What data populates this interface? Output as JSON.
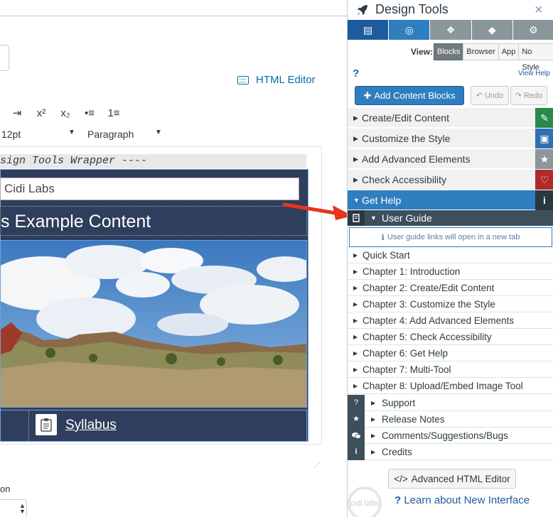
{
  "editor": {
    "html_editor_label": "HTML Editor",
    "toolbar": {
      "indent": "⇥",
      "superscript": "x²",
      "subscript": "x₂",
      "bullet_list": "•≡",
      "numbered_list": "1≡",
      "font_size": "12pt",
      "format": "Paragraph"
    },
    "wrapper_comment": "sign Tools Wrapper ----",
    "header_text": "Cidi Labs",
    "page_title": "s Example Content",
    "syllabus_link": "Syllabus",
    "bottom_label": "on"
  },
  "panel": {
    "title": "Design Tools",
    "close": "×",
    "tabs": [
      {
        "icon": "layout-icon",
        "glyph": "▤"
      },
      {
        "icon": "target-icon",
        "glyph": "◎"
      },
      {
        "icon": "cubes-icon",
        "glyph": "❖"
      },
      {
        "icon": "tags-icon",
        "glyph": "◆"
      },
      {
        "icon": "gears-icon",
        "glyph": "⚙"
      }
    ],
    "view": {
      "label": "View:",
      "options": [
        "Blocks",
        "Browser",
        "App",
        "No Style"
      ],
      "selected": "Blocks"
    },
    "help_mark": "?",
    "view_help": "View Help",
    "add_content_blocks": "Add Content Blocks",
    "undo": "Undo",
    "redo": "Redo",
    "sections": [
      {
        "label": "Create/Edit Content",
        "side_color": "#2a8a4a",
        "side_glyph": "✎"
      },
      {
        "label": "Customize the Style",
        "side_color": "#2f6fb5",
        "side_glyph": "▣"
      },
      {
        "label": "Add Advanced Elements",
        "side_color": "#8b969a",
        "side_glyph": "★"
      },
      {
        "label": "Check Accessibility",
        "side_color": "#b02a2a",
        "side_glyph": "♡"
      },
      {
        "label": "Get Help",
        "side_color": "#2b3842",
        "side_glyph": "i"
      }
    ],
    "user_guide": {
      "label": "User Guide",
      "notice": "User guide links will open in a new tab",
      "chapters": [
        "Quick Start",
        "Chapter 1: Introduction",
        "Chapter 2: Create/Edit Content",
        "Chapter 3: Customize the Style",
        "Chapter 4: Add Advanced Elements",
        "Chapter 5: Check Accessibility",
        "Chapter 6: Get Help",
        "Chapter 7: Multi-Tool",
        "Chapter 8: Upload/Embed Image Tool"
      ]
    },
    "resources": [
      {
        "label": "Support",
        "icon": "question-icon",
        "glyph": "?"
      },
      {
        "label": "Release Notes",
        "icon": "star-icon",
        "glyph": "★"
      },
      {
        "label": "Comments/Suggestions/Bugs",
        "icon": "comments-icon",
        "glyph": "💬"
      },
      {
        "label": "Credits",
        "icon": "info-icon",
        "glyph": "i"
      }
    ],
    "advanced_html_editor": "Advanced HTML Editor",
    "learn_link": "Learn about New Interface",
    "watermark": "cidi labs"
  },
  "colors": {
    "accent": "#2f7ebf",
    "dark_bar": "#2f3e5c",
    "arrow": "#e8341c"
  }
}
